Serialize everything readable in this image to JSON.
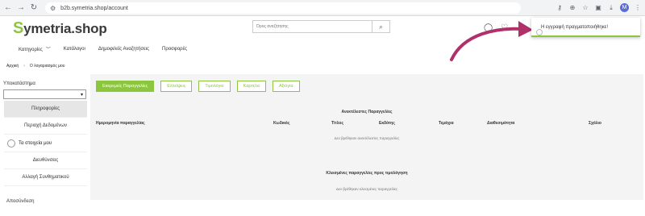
{
  "browser": {
    "url": "b2b.symetria.shop/account"
  },
  "logo": {
    "mark": "S",
    "name": "ymetria.shop"
  },
  "search": {
    "placeholder": "Όρος αναζήτησης"
  },
  "toast": {
    "message": "Η εγγραφή πραγματοποιήθηκε!"
  },
  "mainnav": {
    "items": [
      "Κατηγορίες",
      "Κατάλογοι",
      "Δημοφιλείς Αναζητήσεις",
      "Προσφορές"
    ]
  },
  "breadcrumb": {
    "home": "Αρχική",
    "current": "Ο λογαριασμός μου"
  },
  "sidebar": {
    "branch_label": "Υποκατάστημα",
    "items": [
      "Πληροφορίες",
      "Περιοχή Δεδομένων",
      "Τα στοιχεία μου",
      "Διευθύνσεις",
      "Αλλαγή Συνθηματικού"
    ],
    "logout": "Αποσύνδεση"
  },
  "tabs": [
    "Εκκρεμείς Παραγγελίες",
    "Ελλείψεις",
    "Τιμολόγιο",
    "Καρτέλα",
    "Αξιόγια"
  ],
  "open_orders": {
    "title": "Ανεκτέλεστες Παραγγελίες",
    "columns": [
      "Ημερομηνία παραγγελίας",
      "Κωδικός",
      "Τίτλος",
      "Εκδότης",
      "Τεμάχια",
      "Διαθεσιμότητα",
      "Σχόλιο"
    ],
    "empty": "Δεν βρέθηκαν ανεκτέλεστες παραγγελίες"
  },
  "closed_orders": {
    "title": "Κλεισμένες παραγγελίες προς τιμολόγηση",
    "empty": "Δεν βρέθηκαν κλεισμένες παραγγελίες"
  },
  "colors": {
    "accent": "#8cc63f",
    "arrow": "#b0306a"
  }
}
